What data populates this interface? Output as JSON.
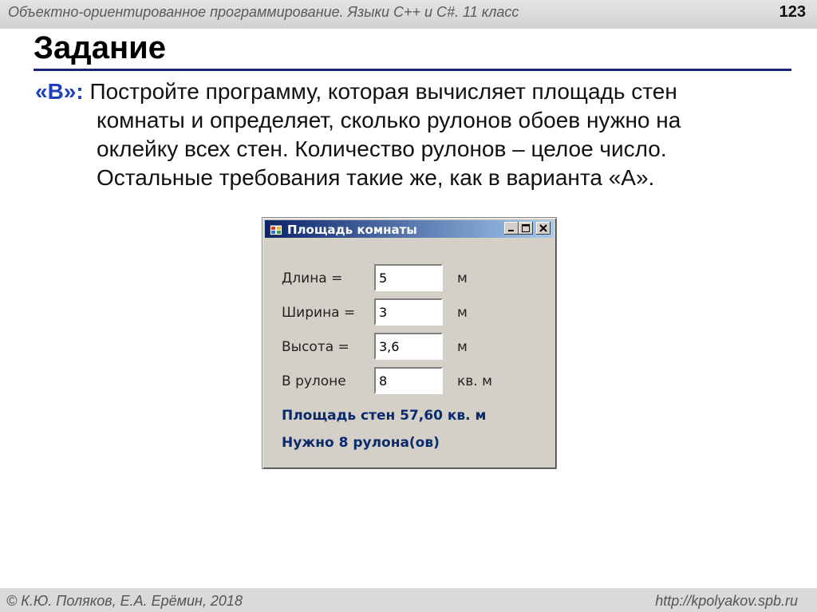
{
  "header": {
    "course": "Объектно-ориентированное программирование. Языки C++ и C#. 11 класс",
    "page_number": "123"
  },
  "title": "Задание",
  "task": {
    "lead": "«B»:",
    "line1": " Постройте программу, которая вычисляет площадь стен",
    "line2": "комнаты и определяет, сколько рулонов обоев нужно на",
    "line3": "оклейку всех стен.  Количество рулонов – целое число.",
    "line4": "Остальные требования такие же, как в варианта «А»."
  },
  "window": {
    "title": "Площадь комнаты",
    "fields": [
      {
        "label": "Длина =",
        "value": "5",
        "unit": "м"
      },
      {
        "label": "Ширина =",
        "value": "3",
        "unit": "м"
      },
      {
        "label": "Высота =",
        "value": "3,6",
        "unit": "м"
      },
      {
        "label": "В рулоне",
        "value": "8",
        "unit": "кв. м"
      }
    ],
    "result_area": "Площадь стен 57,60 кв. м",
    "result_rolls": "Нужно 8 рулона(ов)",
    "icons": [
      "app-icon",
      "minimize-icon",
      "maximize-icon",
      "close-icon"
    ]
  },
  "footer": {
    "copyright": "© К.Ю. Поляков, Е.А. Ерёмин, 2018",
    "url": "http://kpolyakov.spb.ru"
  }
}
